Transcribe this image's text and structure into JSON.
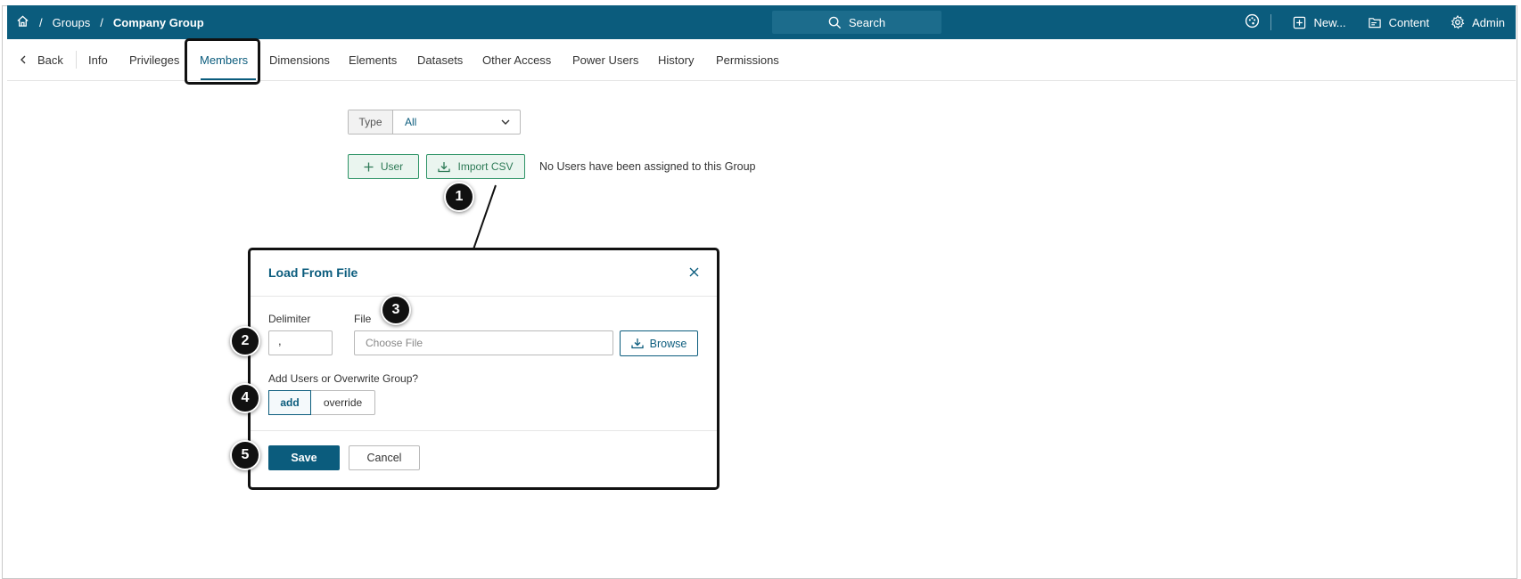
{
  "breadcrumb": {
    "items": [
      "Groups",
      "Company Group"
    ],
    "separator": "/"
  },
  "search": {
    "label": "Search"
  },
  "topnav": {
    "new_label": "New...",
    "content_label": "Content",
    "admin_label": "Admin"
  },
  "tabs": {
    "back": "Back",
    "items": [
      "Info",
      "Privileges",
      "Members",
      "Dimensions",
      "Elements",
      "Datasets",
      "Other Access",
      "Power Users",
      "History",
      "Permissions"
    ],
    "active": "Members"
  },
  "filter": {
    "type_label": "Type",
    "type_value": "All"
  },
  "actions": {
    "user_label": "User",
    "import_label": "Import CSV",
    "empty_message": "No Users have been assigned to this Group"
  },
  "modal": {
    "title": "Load From File",
    "delimiter_label": "Delimiter",
    "delimiter_value": ",",
    "file_label": "File",
    "file_placeholder": "Choose File",
    "browse_label": "Browse",
    "mode_question": "Add Users or Overwrite Group?",
    "mode_options": [
      "add",
      "override"
    ],
    "mode_selected": "add",
    "save_label": "Save",
    "cancel_label": "Cancel"
  },
  "markers": [
    "1",
    "2",
    "3",
    "4",
    "5"
  ],
  "colors": {
    "brand": "#0b5c7d",
    "action_green": "#2d9366",
    "marker": "#111111"
  }
}
